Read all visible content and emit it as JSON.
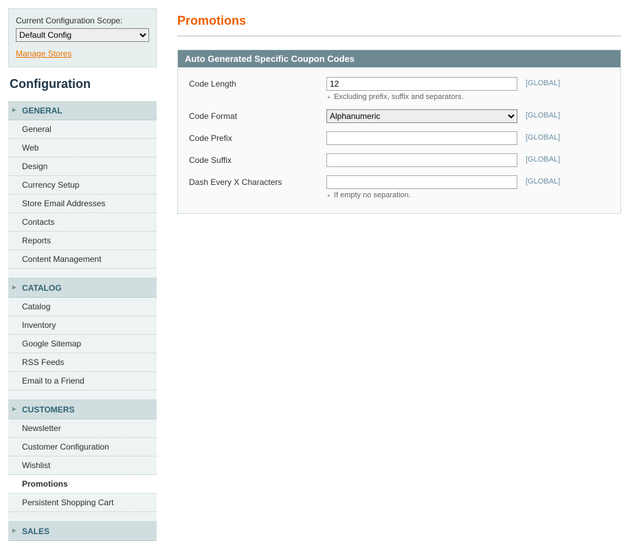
{
  "sidebar": {
    "scope_label": "Current Configuration Scope:",
    "scope_value": "Default Config",
    "manage_stores": "Manage Stores",
    "config_title": "Configuration",
    "sections": [
      {
        "header": "GENERAL",
        "items": [
          {
            "label": "General"
          },
          {
            "label": "Web"
          },
          {
            "label": "Design"
          },
          {
            "label": "Currency Setup"
          },
          {
            "label": "Store Email Addresses"
          },
          {
            "label": "Contacts"
          },
          {
            "label": "Reports"
          },
          {
            "label": "Content Management"
          }
        ]
      },
      {
        "header": "CATALOG",
        "items": [
          {
            "label": "Catalog"
          },
          {
            "label": "Inventory"
          },
          {
            "label": "Google Sitemap"
          },
          {
            "label": "RSS Feeds"
          },
          {
            "label": "Email to a Friend"
          }
        ]
      },
      {
        "header": "CUSTOMERS",
        "items": [
          {
            "label": "Newsletter"
          },
          {
            "label": "Customer Configuration"
          },
          {
            "label": "Wishlist"
          },
          {
            "label": "Promotions",
            "active": true
          },
          {
            "label": "Persistent Shopping Cart"
          }
        ]
      },
      {
        "header": "SALES",
        "items": []
      }
    ]
  },
  "main": {
    "title": "Promotions",
    "fieldset": {
      "legend": "Auto Generated Specific Coupon Codes",
      "rows": [
        {
          "label": "Code Length",
          "value": "12",
          "type": "text",
          "note": "Excluding prefix, suffix and separators.",
          "scope": "[GLOBAL]"
        },
        {
          "label": "Code Format",
          "value": "Alphanumeric",
          "type": "select",
          "scope": "[GLOBAL]"
        },
        {
          "label": "Code Prefix",
          "value": "",
          "type": "text",
          "scope": "[GLOBAL]"
        },
        {
          "label": "Code Suffix",
          "value": "",
          "type": "text",
          "scope": "[GLOBAL]"
        },
        {
          "label": "Dash Every X Characters",
          "value": "",
          "type": "text",
          "note": "If empty no separation.",
          "scope": "[GLOBAL]"
        }
      ]
    }
  }
}
